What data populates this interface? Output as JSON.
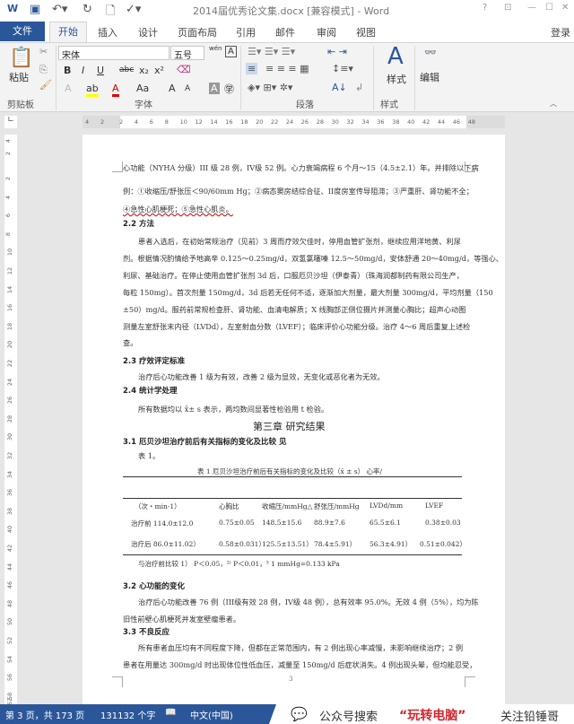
{
  "window": {
    "title": "2014届优秀论文集.docx [兼容模式] - Word",
    "help": "?",
    "restore_ribbon": "⊡",
    "minimize": "—",
    "maximize": "☐",
    "close": "✕"
  },
  "tabs": {
    "file": "文件",
    "items": [
      "开始",
      "插入",
      "设计",
      "页面布局",
      "引用",
      "邮件",
      "审阅",
      "视图"
    ],
    "login": "登录"
  },
  "ribbon": {
    "clipboard": {
      "paste": "粘贴",
      "label": "剪贴板"
    },
    "font": {
      "name": "宋体",
      "size": "五号",
      "bold": "B",
      "italic": "I",
      "underline": "U",
      "strike": "abc",
      "sub": "x₂",
      "sup": "x²",
      "change_case": "Aa",
      "grow": "A",
      "shrink": "A",
      "label": "字体",
      "phonetic": "wén",
      "border_char": "A"
    },
    "paragraph": {
      "label": "段落"
    },
    "styles": {
      "button": "样式",
      "label": "样式"
    },
    "editing": {
      "button": "编辑"
    }
  },
  "ruler": {
    "h_labels": [
      "4",
      "2",
      "2",
      "4",
      "6",
      "8",
      "10",
      "12",
      "14",
      "16",
      "18",
      "20",
      "22",
      "24",
      "26",
      "28",
      "30",
      "32",
      "34",
      "36",
      "38",
      "40",
      "42",
      "44",
      "46",
      "48"
    ],
    "v_labels": [
      "4",
      "2",
      "2",
      "4",
      "6",
      "8",
      "10",
      "12",
      "14",
      "16",
      "18",
      "20",
      "22",
      "24",
      "26",
      "28",
      "30",
      "32",
      "34",
      "36",
      "38",
      "40",
      "42",
      "44",
      "46",
      "48",
      "50",
      "52",
      "54",
      "56",
      "58",
      "62"
    ]
  },
  "document": {
    "lines": [
      "心功能（NYHA 分级）III 级 28 例，IV级 52 例。心力衰竭病程 6 个月～15（4.5±2.1）年。并排除以下病",
      "例：①收缩压/舒张压＜90/60mm Hg；②病态窦房结综合征、II度房室传导阻滞；③严重肝、肾功能不全；",
      "④急性心肌梗死；⑤急性心肌炎。"
    ],
    "s22": "2.2  方法",
    "p22": [
      "患者入选后，在初始常规治疗（见前）3 周而疗效欠佳时，停用血管扩张剂，继续应用洋地黄、利尿",
      "剂。根据情况酌情给予地高辛 0.125～0.25mg/d，双氢氯噻嗪 12.5～50mg/d，安体舒通 20～40mg/d，等强心、",
      "利尿、基础治疗。在停止使用血管扩张剂 3d 后，口服厄贝沙坦（伊泰青）（珠海润都制药有限公司生产，",
      "每粒 150mg）。首次剂量 150mg/d，3d 后若无任何不适，逐渐加大剂量，最大剂量 300mg/d，平均剂量（150",
      "±50）mg/d。服药前常规检查肝、肾功能、血清电解质；X 线胸部正侧位摄片并测量心胸比；超声心动图",
      "测量左室舒张末内径（LVDd），左室射血分数（LVEF）；临床评价心功能分级。治疗 4～6 周后重复上述检",
      "查。"
    ],
    "s23": "2.3  疗效评定标准",
    "p23": "治疗后心功能改善 1 级为有效，改善 2 级为显效，无变化或恶化者为无效。",
    "s24": "2.4  统计学处理",
    "p24": "所有数据均以 x̄± s 表示，两均数间显著性检验用 t 检验。",
    "chapter": "第三章   研究结果",
    "s31": "3.1 厄贝沙坦治疗前后有关指标的变化及比较 见",
    "p31": "表 1。",
    "table_caption": "表 1  厄贝沙坦治疗前后有关指标的变化及比较（x̄ ± s）  心率/",
    "table": {
      "headers": [
        "（次・min-1）",
        "心胸比",
        "收缩压/mmHg△",
        "舒张压/mmHg",
        "LVDd/mm",
        "LVEF"
      ],
      "rows": [
        [
          "治疗前  114.0±12.0",
          "0.75±0.05",
          "148.5±15.6",
          "88.9±7.6",
          "65.5±6.1",
          "0.38±0.03"
        ],
        [
          "治疗后  86.0±11.02）",
          "0.58±0.031）",
          "125.5±13.51）",
          "78.4±5.91）",
          "56.3±4.91）",
          "0.51±0.042）"
        ]
      ]
    },
    "table_note": "与治疗前比较 1） P＜0.05，²⁾ P＜0.01，³  1 mmHg=0.133 kPa",
    "s32": "3.2  心功能的变化",
    "p32": [
      "治疗后心功能改善 76 例（III级有效 28 例，IV级 48 例），总有效率 95.0%。无效 4 例（5%），均为陈",
      "旧性前壁心肌梗死并发室壁瘤患者。"
    ],
    "s33": "3.3  不良反应",
    "p33": [
      "所有患者血压均有不同程度下降，但都在正常范围内，有 2 例出现心率减慢，未影响继续治疗；2 例",
      "患者在用量达 300mg/d 时出现体位性低血压，减量至 150mg/d 后症状消失。4 例出现头晕，但均能忍受，"
    ],
    "page_number": "3"
  },
  "status": {
    "page": "第 3 页，共 173 页",
    "words": "131132 个字",
    "language": "中文(中国)"
  },
  "watermark": {
    "text1": "公众号搜索",
    "text2": "“玩转电脑”",
    "text3": "关注铅锤哥"
  },
  "colors": {
    "accent": "#2b579a",
    "watermark_red": "#d0262c"
  }
}
